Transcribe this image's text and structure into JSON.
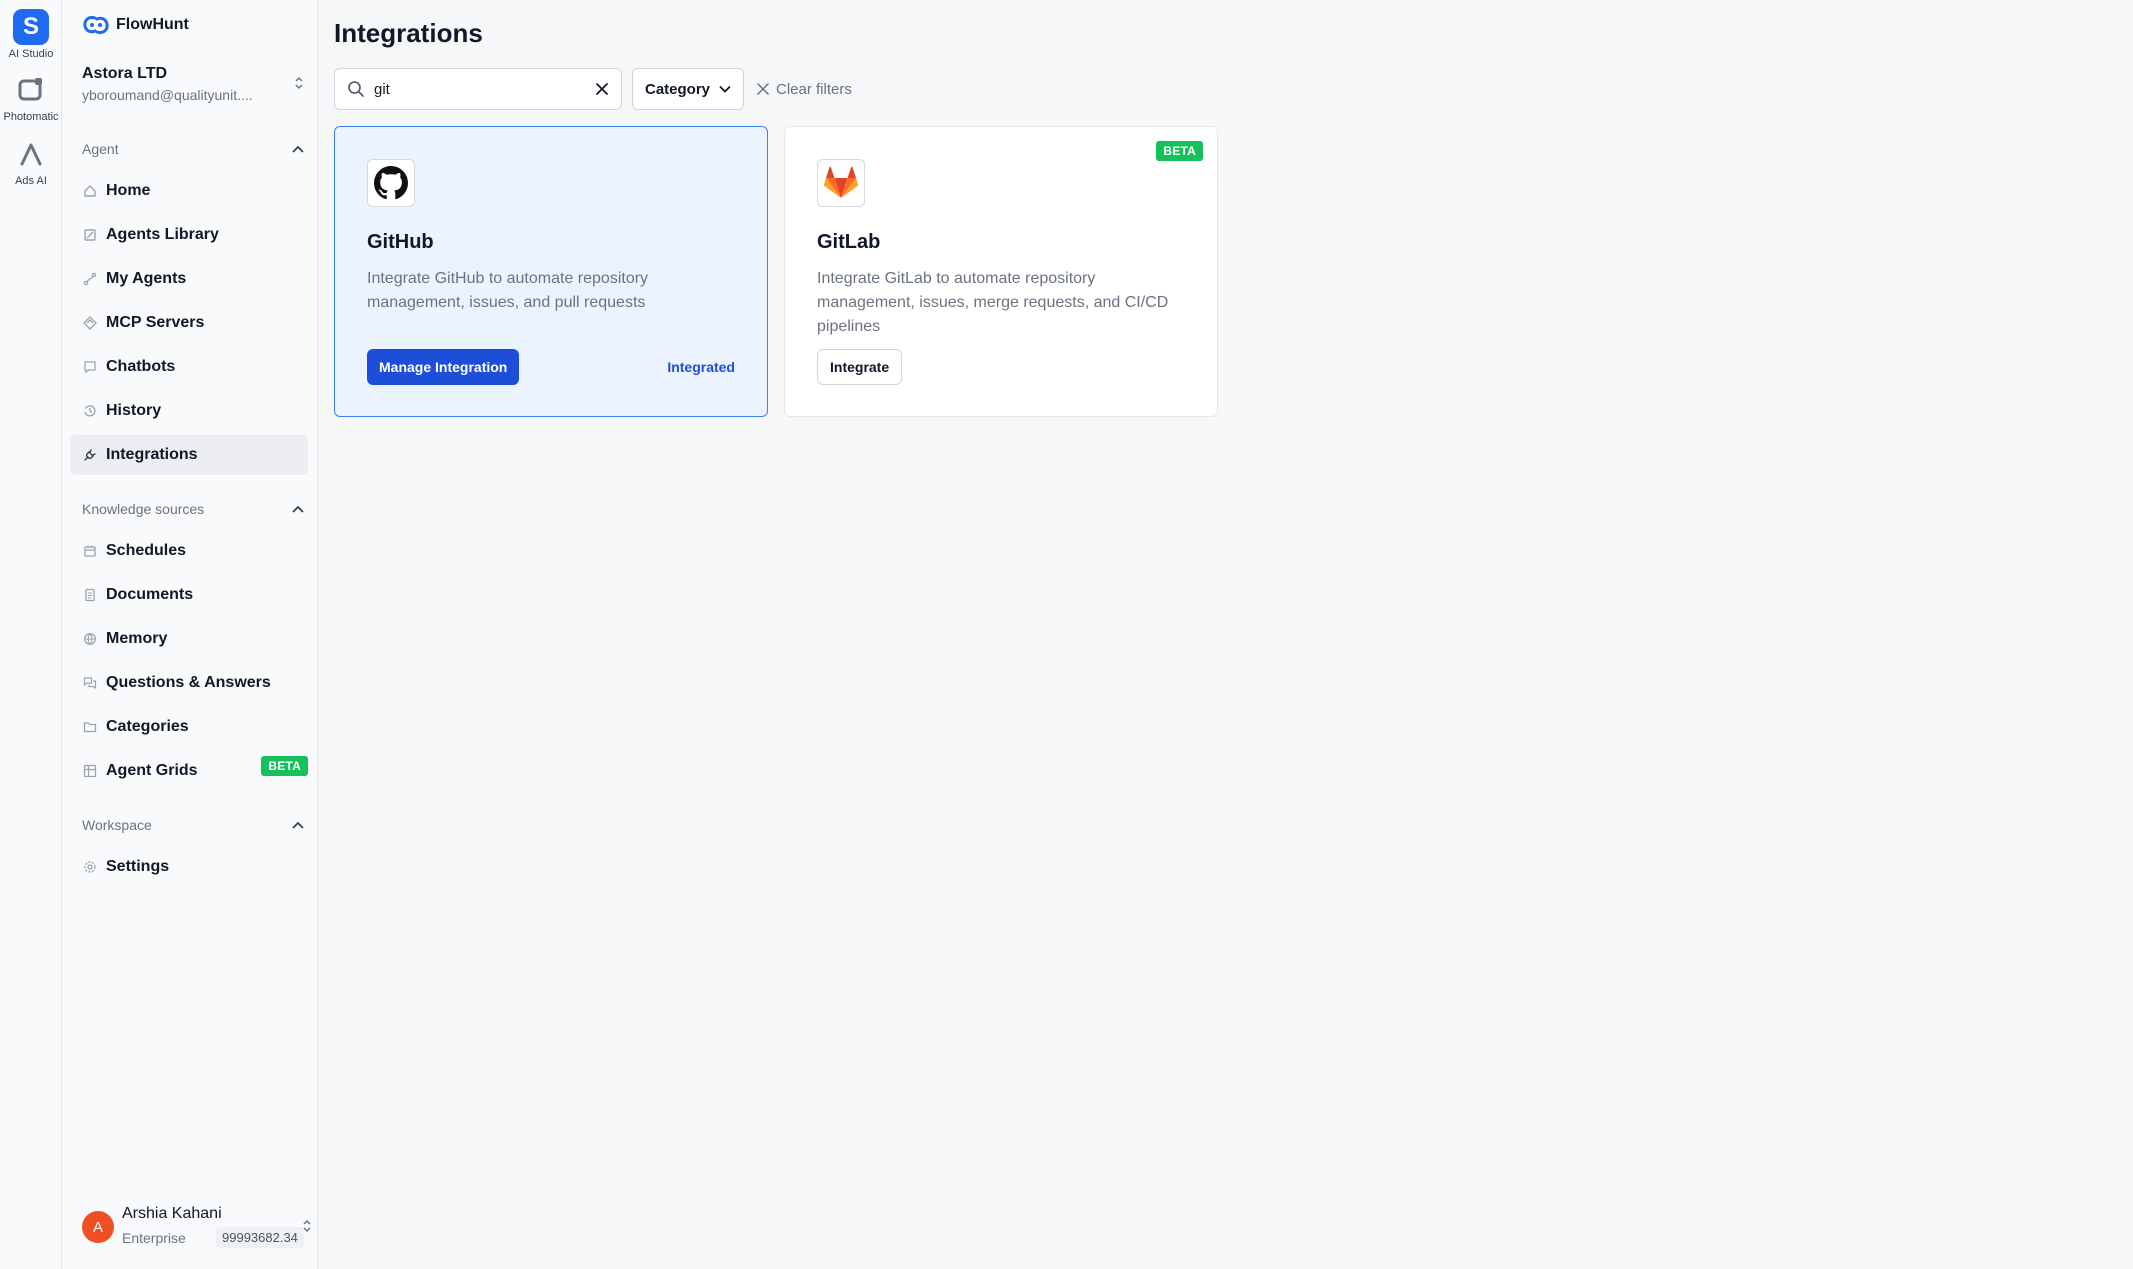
{
  "rail": {
    "items": [
      {
        "label": "AI Studio"
      },
      {
        "label": "Photomatic"
      },
      {
        "label": "Ads AI"
      }
    ]
  },
  "sidebar": {
    "brand": "FlowHunt",
    "org": {
      "name": "Astora LTD",
      "email": "yboroumand@qualityunit...."
    },
    "sections": {
      "agent": "Agent",
      "knowledge": "Knowledge sources",
      "workspace": "Workspace"
    },
    "agent_items": [
      "Home",
      "Agents Library",
      "My Agents",
      "MCP Servers",
      "Chatbots",
      "History",
      "Integrations"
    ],
    "knowledge_items": [
      "Schedules",
      "Documents",
      "Memory",
      "Questions & Answers",
      "Categories",
      "Agent Grids"
    ],
    "workspace_items": [
      "Settings"
    ],
    "beta_label": "BETA",
    "user": {
      "initial": "A",
      "name": "Arshia Kahani",
      "plan": "Enterprise",
      "credits": "99993682.34"
    }
  },
  "main": {
    "title": "Integrations",
    "search": {
      "value": "git"
    },
    "filter_label": "Category",
    "clear_label": "Clear filters",
    "cards": [
      {
        "name": "GitHub",
        "description": "Integrate GitHub to automate repository management, issues, and pull requests",
        "button": "Manage Integration",
        "status": "Integrated",
        "icon": "github-icon"
      },
      {
        "name": "GitLab",
        "description": "Integrate GitLab to automate repository management, issues, merge requests, and CI/CD pipelines",
        "button": "Integrate",
        "badge": "BETA",
        "icon": "gitlab-icon"
      }
    ]
  },
  "colors": {
    "accent": "#1d4ed8",
    "beta": "#16c05b",
    "selected_card_bg": "#eaf3fe",
    "avatar": "#f04f23"
  }
}
